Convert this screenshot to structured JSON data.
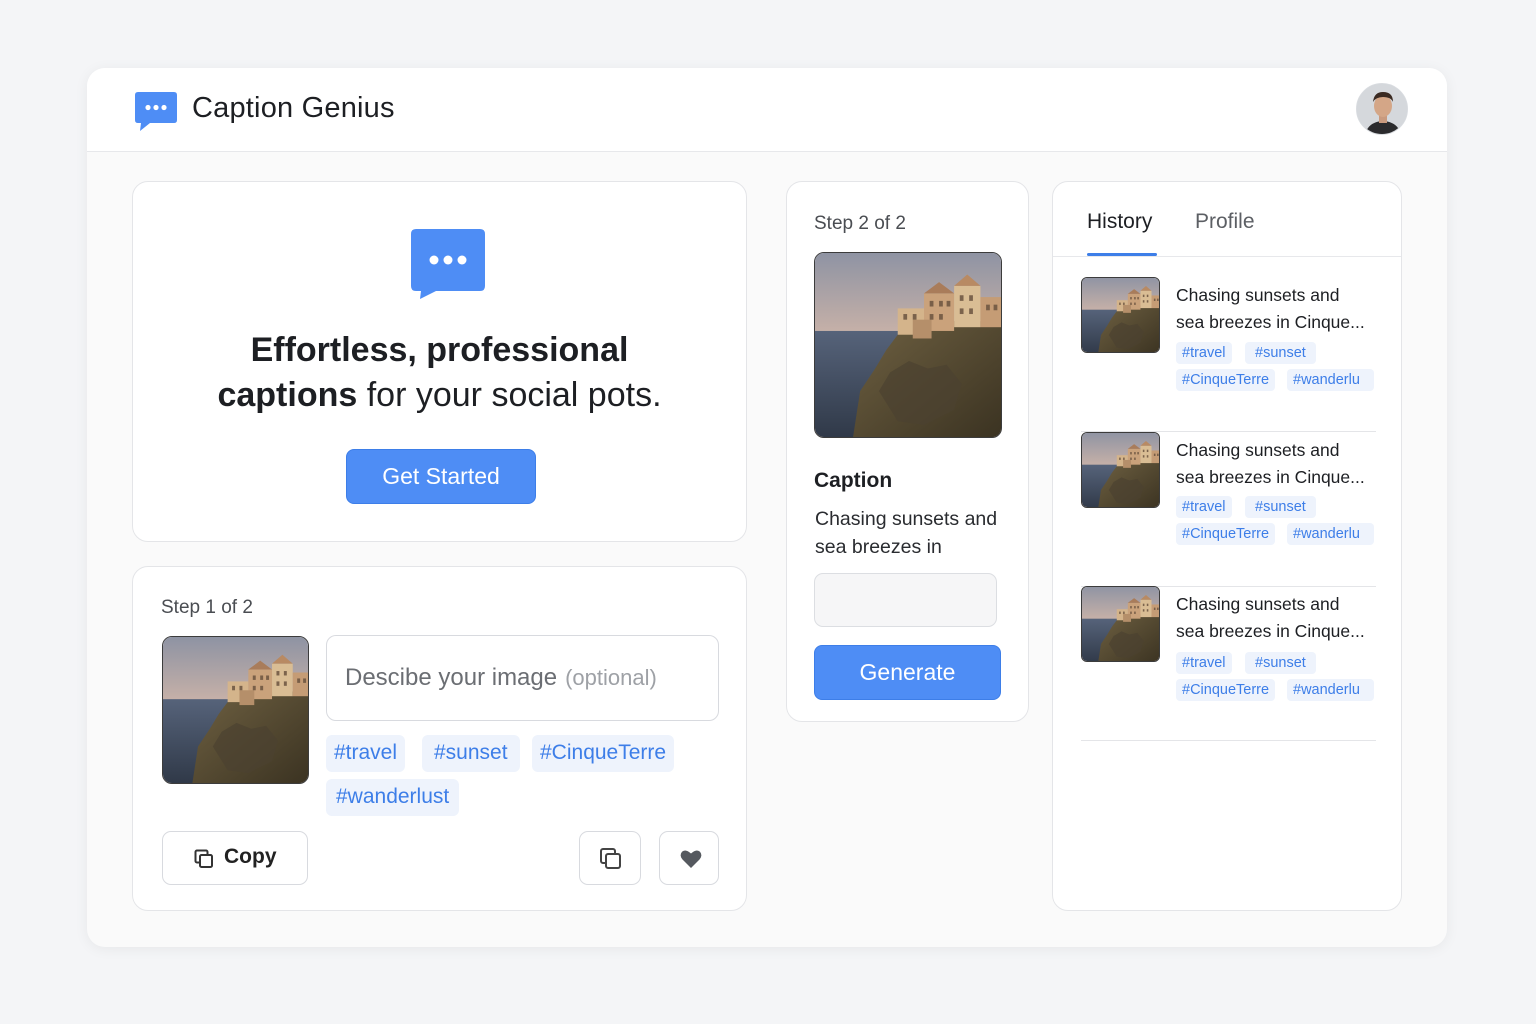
{
  "app": {
    "title": "Caption Genius"
  },
  "hero": {
    "line1_bold": "Effortless, professional",
    "line2_bold": "captions",
    "line2_rest": " for your social pots.",
    "cta_label": "Get Started"
  },
  "step1": {
    "label": "Step 1 of 2",
    "input_placeholder": "Descibe your image",
    "input_optional": "(optional)",
    "tags": [
      "#travel",
      "#sunset",
      "#CinqueTerre",
      "#wanderlust"
    ],
    "copy_label": "Copy"
  },
  "step2": {
    "label": "Step 2 of 2",
    "caption_heading": "Caption",
    "caption_text": "Chasing sunsets and sea breezes in",
    "generate_label": "Generate"
  },
  "history": {
    "tabs": [
      "History",
      "Profile"
    ],
    "items": [
      {
        "line1": "Chasing sunsets and",
        "line2": "sea breezes in Cinque...",
        "tags": [
          "#travel",
          "#sunset",
          "#CinqueTerre",
          "#wanderlu"
        ]
      },
      {
        "line1": "Chasing sunsets and",
        "line2": "sea breezes in Cinque...",
        "tags": [
          "#travel",
          "#sunset",
          "#CinqueTerre",
          "#wanderlu"
        ]
      },
      {
        "line1": "Chasing sunsets and",
        "line2": "sea breezes in Cinque...",
        "tags": [
          "#travel",
          "#sunset",
          "#CinqueTerre",
          "#wanderlu"
        ]
      }
    ]
  },
  "colors": {
    "accent": "#4e8df5",
    "tag_bg": "#eef3fc",
    "tag_text": "#3d7ee8"
  },
  "icons": {
    "logo": "chat-bubble-icon",
    "copy": "copy-icon",
    "favorite": "heart-icon"
  }
}
